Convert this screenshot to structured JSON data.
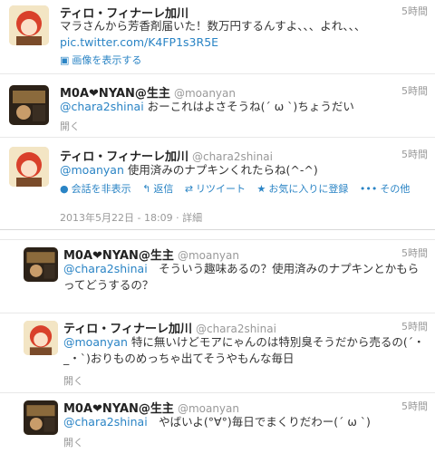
{
  "tweets": [
    {
      "name": "ティロ・フィナーレ加川",
      "handle": "",
      "time": "5時間",
      "text": "マラさんから芳香剤届いた！数万円するんすよ、、、よれ、、、",
      "link": "pic.twitter.com/K4FP1s3R5E",
      "footer": "画像を表示する"
    },
    {
      "name": "M0A❤NYAN@生主",
      "handle": "@moanyan",
      "time": "5時間",
      "mention": "@chara2shinai",
      "text": " おーこれはよさそうね(´ ω ˋ)ちょうだい",
      "footer": "開く"
    },
    {
      "name": "ティロ・フィナーレ加川",
      "handle": "@chara2shinai",
      "time": "5時間",
      "mention": "@moanyan",
      "text": " 使用済みのナプキンくれたらね(^-^)",
      "actions": {
        "hide_conversation": "会話を非表示",
        "reply": "返信",
        "retweet": "リツイート",
        "favorite": "お気に入りに登録",
        "more": "その他"
      },
      "date": "2013年5月22日 - 18:09 · 詳細"
    },
    {
      "name": "M0A❤NYAN@生主",
      "handle": "@moanyan",
      "time": "5時間",
      "mention": "@chara2shinai",
      "text": "　そういう趣味あるの？使用済みのナプキンとかもらってどうするの？",
      "footer": "開く"
    },
    {
      "name": "ティロ・フィナーレ加川",
      "handle": "@chara2shinai",
      "time": "5時間",
      "mention": "@moanyan",
      "text": " 特に無いけどモアにゃんのは特別臭そうだから売るの(´・_・`)おりものめっちゃ出てそうやもんな毎日",
      "footer": "開く"
    },
    {
      "name": "M0A❤NYAN@生主",
      "handle": "@moanyan",
      "time": "5時間",
      "mention": "@chara2shinai",
      "text": "　やばいよ(°∀°)毎日でまくりだわー(´ ω ˋ)",
      "footer": "開く"
    }
  ],
  "colors": {
    "link": "#2a84c5",
    "muted": "#999999",
    "border": "#e8e8e8"
  },
  "icons": {
    "image": "image-icon",
    "hide": "conversation-icon",
    "reply": "reply-icon",
    "retweet": "retweet-icon",
    "favorite": "star-icon",
    "more": "more-dots-icon"
  }
}
